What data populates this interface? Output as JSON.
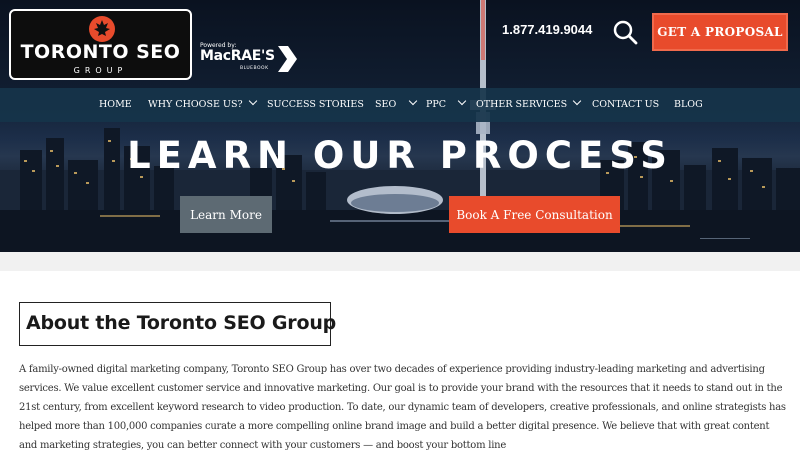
{
  "brand": {
    "logo_title": "TORONTO SEO",
    "logo_sub": "GROUP",
    "powered_by": "Powered by:",
    "partner_name": "MacRAE'S",
    "partner_sub": "BLUEBOOK"
  },
  "header": {
    "phone": "1.877.419.9044",
    "proposal_label": "GET A PROPOSAL",
    "search_icon": "search-icon"
  },
  "nav": {
    "items": [
      {
        "label": "HOME",
        "has_dropdown": false
      },
      {
        "label": "WHY CHOOSE US?",
        "has_dropdown": true
      },
      {
        "label": "SUCCESS STORIES",
        "has_dropdown": false
      },
      {
        "label": "SEO",
        "has_dropdown": true
      },
      {
        "label": "PPC",
        "has_dropdown": true
      },
      {
        "label": "OTHER SERVICES",
        "has_dropdown": true
      },
      {
        "label": "CONTACT US",
        "has_dropdown": false
      },
      {
        "label": "BLOG",
        "has_dropdown": false
      }
    ]
  },
  "hero": {
    "title": "LEARN OUR PROCESS",
    "learn_more_label": "Learn More",
    "consultation_label": "Book A Free Consultation"
  },
  "about": {
    "title": "About the Toronto SEO Group",
    "body": "A family-owned digital marketing company, Toronto SEO Group has over two decades of experience providing industry-leading marketing and advertising services. We value excellent customer service and innovative marketing. Our goal is to provide your brand with the resources that it needs to stand out in the 21st century, from excellent keyword research to video production. To date, our dynamic team of developers, creative professionals, and online strategists has helped more than 100,000 companies curate a more compelling online brand image and build a better digital presence. We believe that with great content and marketing strategies, you can better connect with your customers — and boost your bottom line"
  },
  "colors": {
    "accent": "#e84b2c",
    "nav_bg": "#16344a",
    "secondary_button": "#5d6a73"
  }
}
